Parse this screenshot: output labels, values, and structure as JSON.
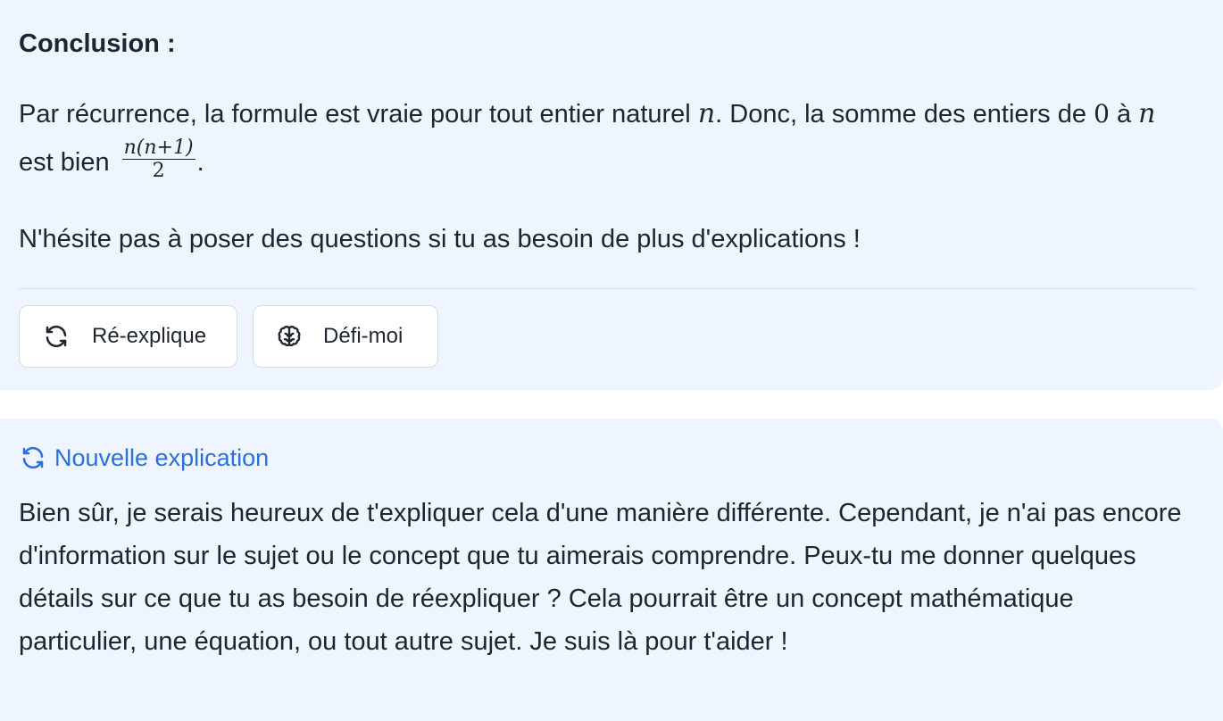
{
  "message_top": {
    "heading": "Conclusion :",
    "para1_part1": "Par récurrence, la formule est vraie pour tout entier naturel ",
    "para1_math_n1": "n",
    "para1_part2": ". Donc, la somme des entiers de ",
    "para1_math_zero": "0",
    "para1_part3": " à ",
    "para1_math_n2": "n",
    "para1_part4": " est bien ",
    "fraction_numerator": "n(n+1)",
    "fraction_denominator": "2",
    "para1_part5": ".",
    "para2": "N'hésite pas à poser des questions si tu as besoin de plus d'explications !",
    "buttons": {
      "reexplain_label": "Ré-explique",
      "reexplain_icon": "refresh-icon",
      "challenge_label": "Défi-moi",
      "challenge_icon": "brain-icon"
    }
  },
  "message_bottom": {
    "tag_label": "Nouvelle explication",
    "tag_icon": "refresh-icon",
    "body": "Bien sûr, je serais heureux de t'expliquer cela d'une manière différente. Cependant, je n'ai pas encore d'information sur le sujet ou le concept que tu aimerais comprendre. Peux-tu me donner quelques détails sur ce que tu as besoin de réexpliquer ? Cela pourrait être un concept mathématique particulier, une équation, ou tout autre sujet. Je suis là pour t'aider !"
  },
  "colors": {
    "card_background": "#eff5fe",
    "accent_blue": "#2a6fdb",
    "text": "#1f2530"
  }
}
